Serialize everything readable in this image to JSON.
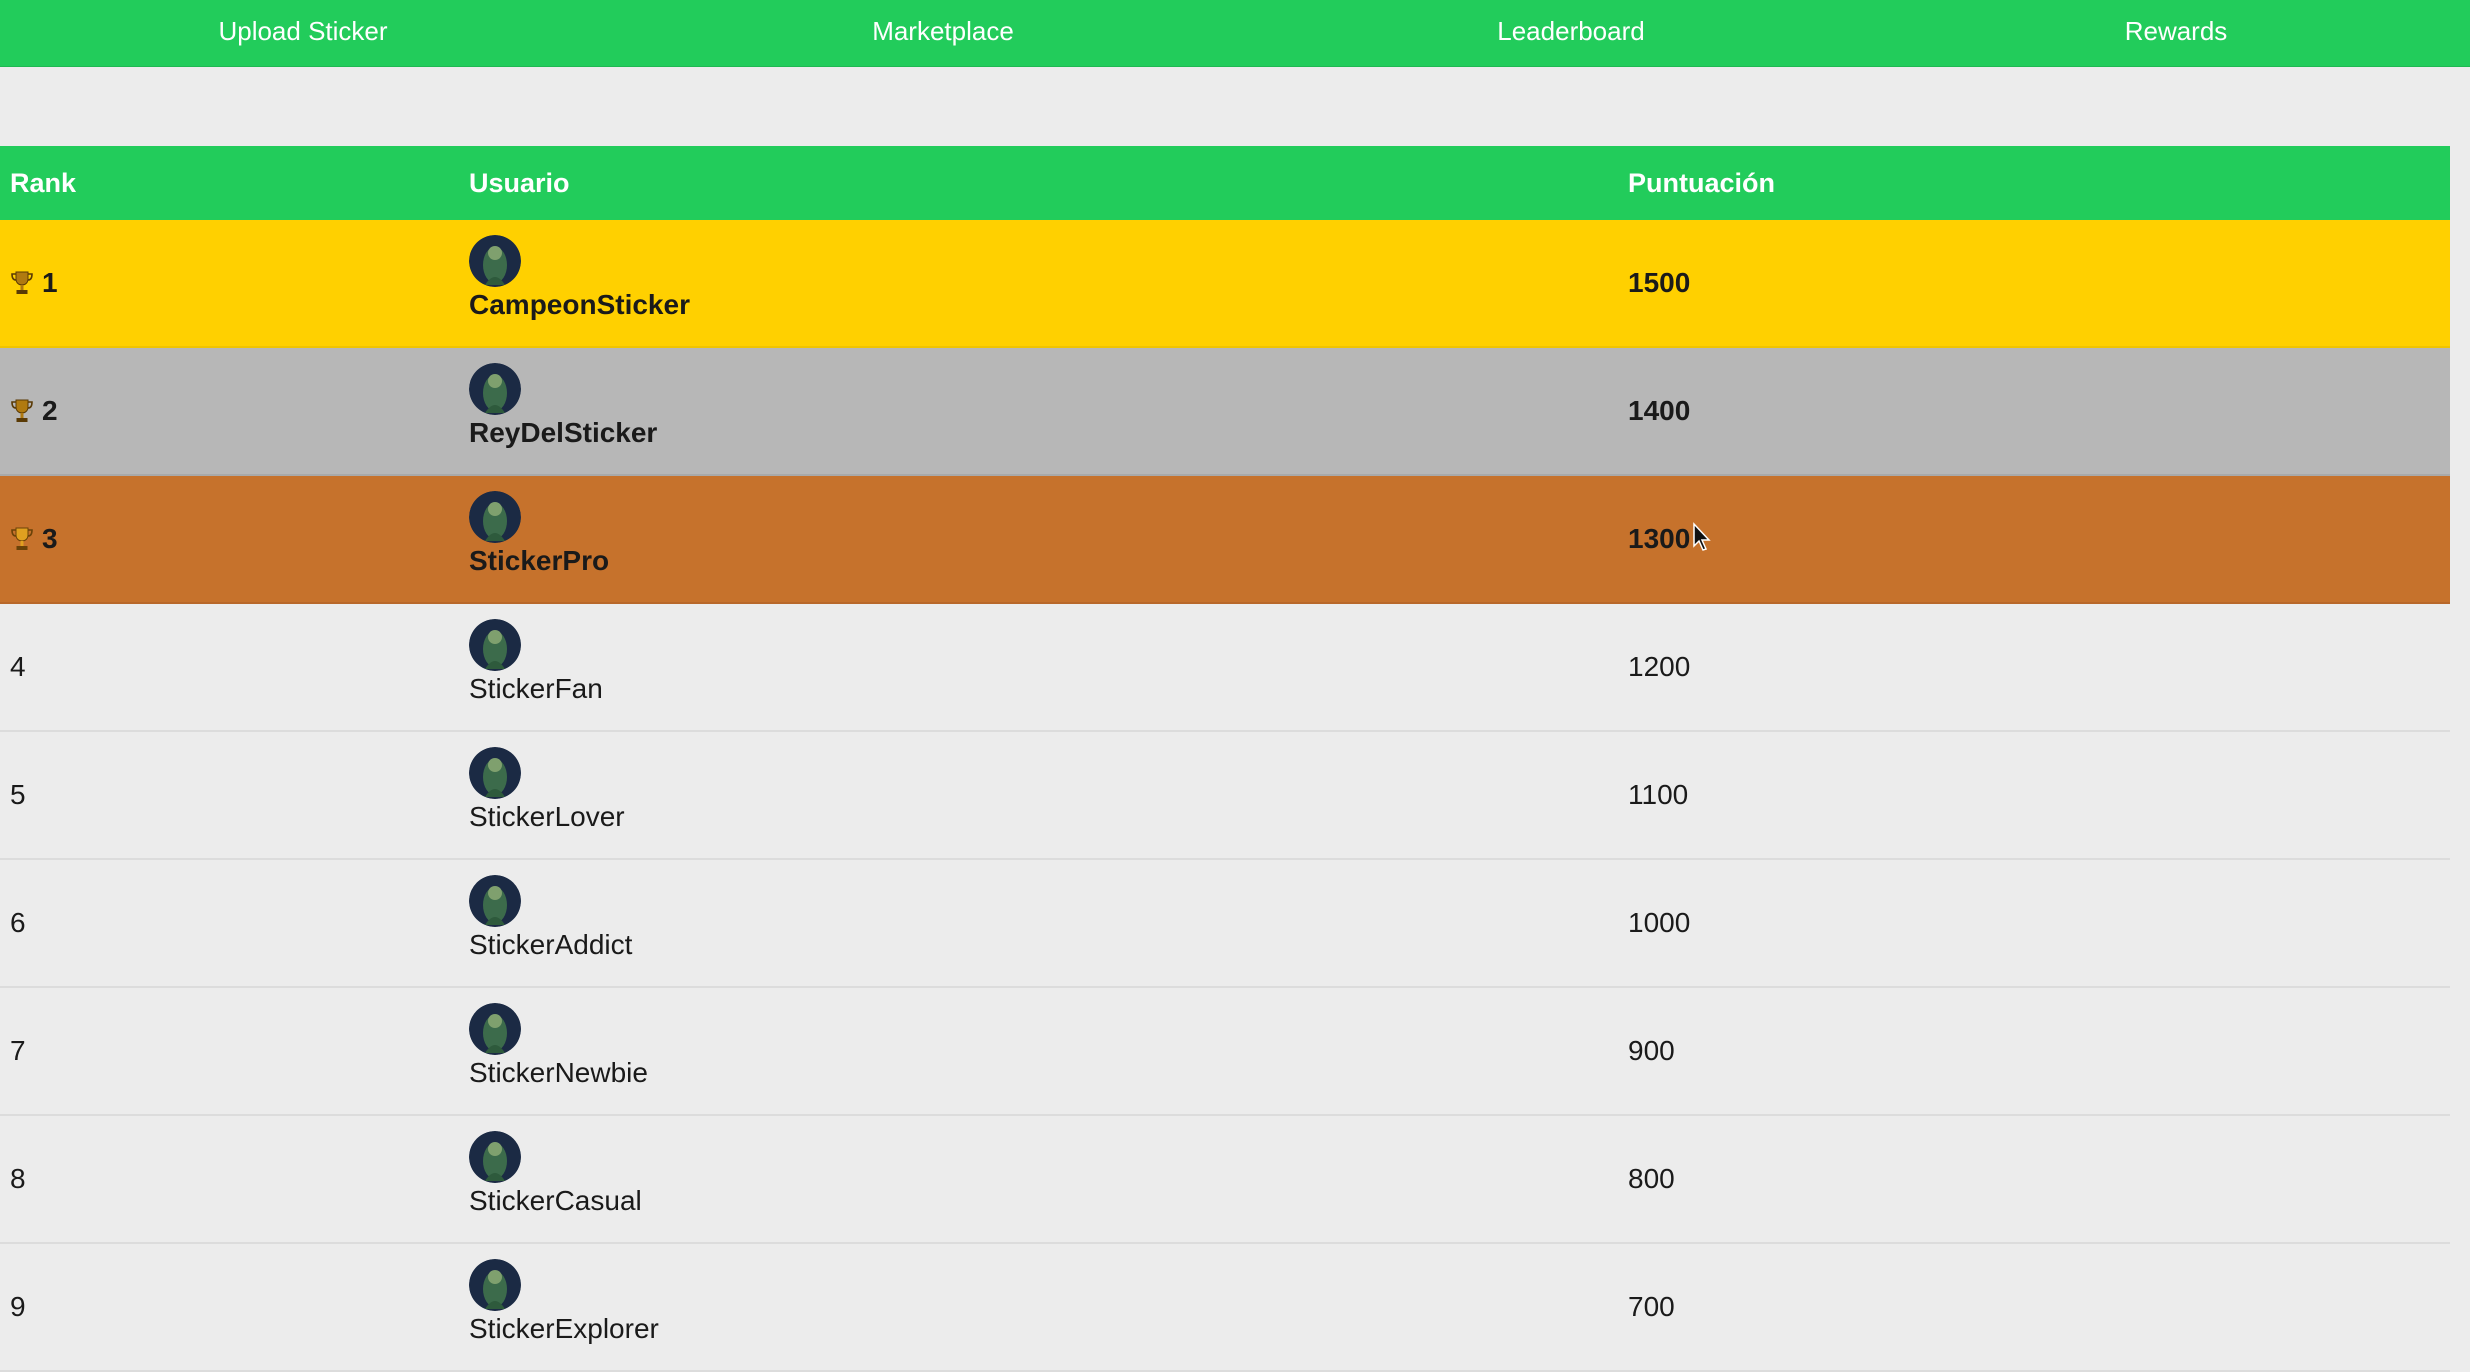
{
  "nav": {
    "upload": "Upload Sticker",
    "marketplace": "Marketplace",
    "leaderboard": "Leaderboard",
    "rewards": "Rewards"
  },
  "table": {
    "headers": {
      "rank": "Rank",
      "user": "Usuario",
      "score": "Puntuación"
    },
    "rows": [
      {
        "rank": "1",
        "user": "CampeonSticker",
        "score": "1500",
        "highlight": "gold",
        "trophy": "trophy-icon"
      },
      {
        "rank": "2",
        "user": "ReyDelSticker",
        "score": "1400",
        "highlight": "silver",
        "trophy": "trophy-icon"
      },
      {
        "rank": "3",
        "user": "StickerPro",
        "score": "1300",
        "highlight": "bronze",
        "trophy": "trophy-icon"
      },
      {
        "rank": "4",
        "user": "StickerFan",
        "score": "1200",
        "highlight": "none"
      },
      {
        "rank": "5",
        "user": "StickerLover",
        "score": "1100",
        "highlight": "none"
      },
      {
        "rank": "6",
        "user": "StickerAddict",
        "score": "1000",
        "highlight": "none"
      },
      {
        "rank": "7",
        "user": "StickerNewbie",
        "score": "900",
        "highlight": "none"
      },
      {
        "rank": "8",
        "user": "StickerCasual",
        "score": "800",
        "highlight": "none"
      },
      {
        "rank": "9",
        "user": "StickerExplorer",
        "score": "700",
        "highlight": "none"
      }
    ]
  },
  "colors": {
    "accent": "#22cc5b",
    "gold": "#ffd000",
    "silver": "#b7b7b7",
    "bronze": "#c6722c",
    "background": "#ececec"
  }
}
